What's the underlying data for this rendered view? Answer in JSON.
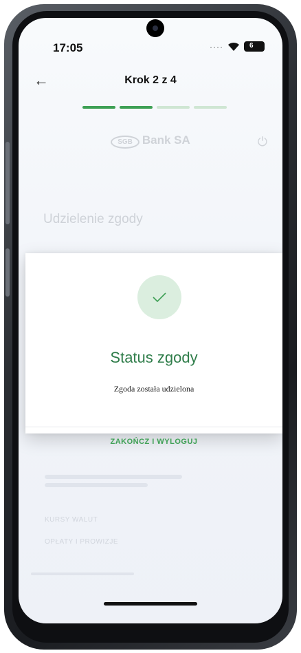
{
  "status_bar": {
    "time": "17:05",
    "battery_label": "6"
  },
  "header": {
    "back_icon": "arrow-left-icon",
    "step_title": "Krok 2 z 4"
  },
  "progress": {
    "total_steps": 4,
    "completed_steps": 2
  },
  "background": {
    "bank_logo_text": "Bank SA",
    "bank_logo_badge": "SGB",
    "section_title": "Udzielenie zgody",
    "link_1": "KURSY WALUT",
    "link_2": "OPŁATY I PROWIZJE"
  },
  "modal": {
    "icon": "checkmark-icon",
    "title": "Status zgody",
    "message": "Zgoda została udzielona",
    "button_label": "ZAKOŃCZ I WYLOGUJ"
  },
  "colors": {
    "accent": "#3ea055",
    "title_green": "#2f7d4a",
    "check_bg": "#dbeedf"
  }
}
